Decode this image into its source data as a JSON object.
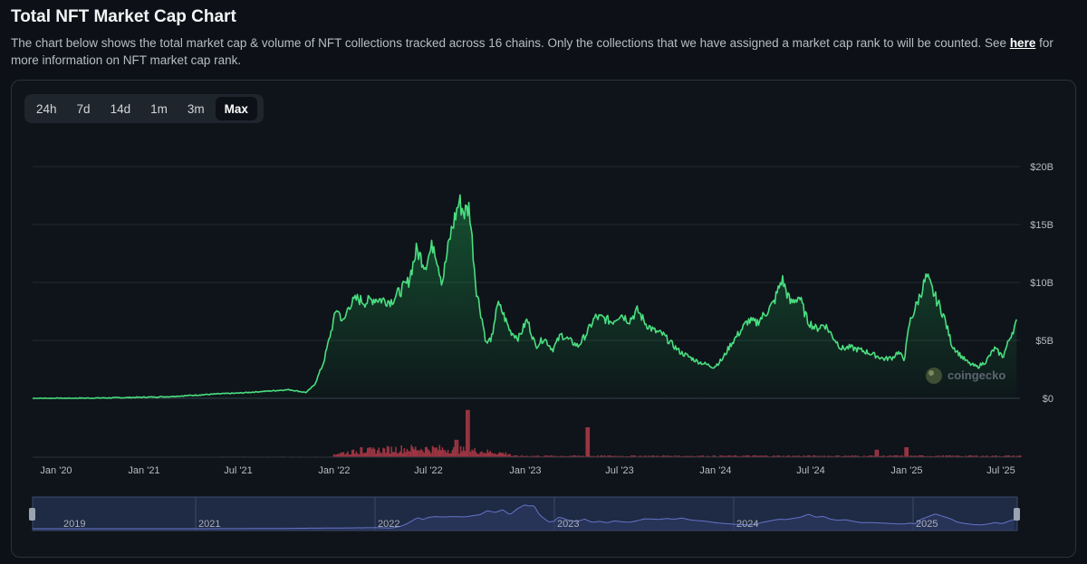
{
  "header": {
    "title": "Total NFT Market Cap Chart",
    "desc_before": "The chart below shows the total market cap & volume of NFT collections tracked across 16 chains. Only the collections that we have assigned a market cap rank to will be counted. See ",
    "link": "here",
    "desc_after": " for more information on NFT market cap rank."
  },
  "range_buttons": [
    "24h",
    "7d",
    "14d",
    "1m",
    "3m",
    "Max"
  ],
  "active_range": "Max",
  "watermark": "coingecko",
  "colors": {
    "line": "#4ade80",
    "volume": "#b43a4a",
    "navigator": "#6474c8"
  },
  "chart_data": {
    "type": "line",
    "y_axis": {
      "ticks": [
        "$0",
        "$5B",
        "$10B",
        "$15B",
        "$20B"
      ],
      "range": [
        0,
        20
      ]
    },
    "x_ticks": [
      "Jan '20",
      "Jan '21",
      "Jul '21",
      "Jan '22",
      "Jul '22",
      "Jan '23",
      "Jul '23",
      "Jan '24",
      "Jul '24",
      "Jan '25",
      "Jul '25"
    ],
    "navigator_labels": [
      "2019",
      "2021",
      "2022",
      "2023",
      "2024",
      "2025"
    ],
    "market_cap": {
      "t": [
        2019.79,
        2020.0,
        2020.3,
        2020.6,
        2020.9,
        2021.0,
        2021.15,
        2021.3,
        2021.4,
        2021.45,
        2021.5,
        2021.55,
        2021.58,
        2021.62,
        2021.65,
        2021.7,
        2021.75,
        2021.8,
        2021.9,
        2022.0,
        2022.05,
        2022.1,
        2022.15,
        2022.2,
        2022.25,
        2022.3,
        2022.33,
        2022.36,
        2022.4,
        2022.43,
        2022.46,
        2022.5,
        2022.52,
        2022.55,
        2022.6,
        2022.65,
        2022.7,
        2022.75,
        2022.8,
        2022.85,
        2022.9,
        2023.0,
        2023.05,
        2023.1,
        2023.15,
        2023.2,
        2023.25,
        2023.3,
        2023.35,
        2023.4,
        2023.45,
        2023.5,
        2023.55,
        2023.6,
        2023.7,
        2023.8,
        2023.85,
        2023.9,
        2024.0,
        2024.05,
        2024.1,
        2024.15,
        2024.2,
        2024.25,
        2024.3,
        2024.35,
        2024.4,
        2024.45,
        2024.5,
        2024.55,
        2024.6,
        2024.7,
        2024.75,
        2024.8,
        2024.85,
        2024.88,
        2024.92,
        2024.95,
        2025.0,
        2025.05,
        2025.1,
        2025.15,
        2025.2,
        2025.25,
        2025.3,
        2025.35,
        2025.4,
        2025.45,
        2025.5,
        2025.55,
        2025.58
      ],
      "v": [
        0,
        0,
        0.05,
        0.15,
        0.4,
        0.45,
        0.6,
        0.75,
        0.5,
        1.2,
        3,
        6,
        7.8,
        6.5,
        8,
        8.6,
        8.3,
        8.6,
        8.4,
        10,
        12.8,
        11.5,
        13.4,
        10,
        14.2,
        17,
        16,
        16.5,
        9.5,
        7.2,
        4.7,
        5.4,
        8.2,
        7.6,
        5.8,
        5.2,
        6.8,
        4.5,
        5.2,
        4.2,
        5.5,
        4.5,
        5.6,
        7,
        6.9,
        6.6,
        7.3,
        6.7,
        7.6,
        6.4,
        5.8,
        5.5,
        4.7,
        4,
        3.2,
        2.7,
        3.4,
        4.7,
        6.7,
        6.5,
        7.3,
        8.2,
        10.3,
        8.2,
        8.8,
        6.7,
        6.0,
        6.4,
        5.3,
        4.3,
        4.4,
        4.0,
        3.7,
        3.4,
        3.5,
        4.0,
        3.4,
        6.5,
        8.4,
        10.5,
        8.8,
        7.2,
        4.6,
        3.7,
        3.0,
        2.7,
        3.2,
        4.3,
        3.6,
        5.6,
        6.5
      ]
    },
    "volume_spikes": [
      {
        "t": 2021.72,
        "v": 0.2
      },
      {
        "t": 2022.28,
        "v": 0.35
      },
      {
        "t": 2022.35,
        "v": 0.95
      },
      {
        "t": 2023.05,
        "v": 0.6
      },
      {
        "t": 2024.75,
        "v": 0.15
      },
      {
        "t": 2024.93,
        "v": 0.2
      }
    ]
  }
}
